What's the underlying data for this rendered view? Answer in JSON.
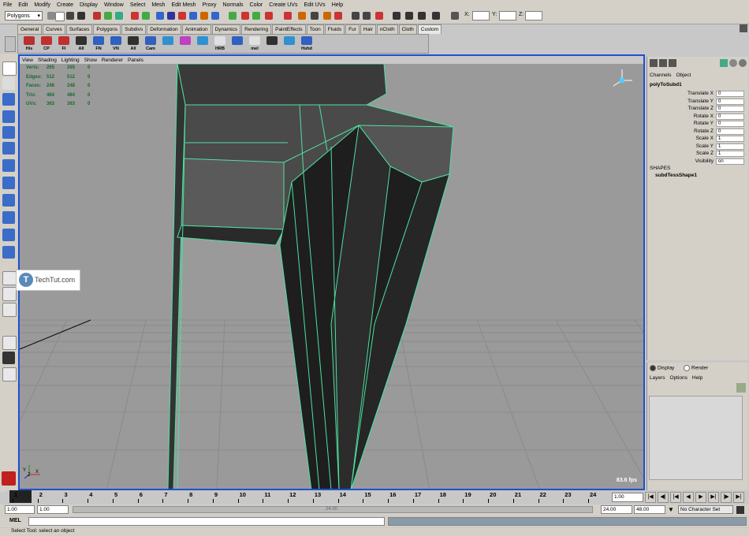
{
  "menubar": [
    "File",
    "Edit",
    "Modify",
    "Create",
    "Display",
    "Window",
    "Select",
    "Mesh",
    "Edit Mesh",
    "Proxy",
    "Normals",
    "Color",
    "Create UVs",
    "Edit UVs",
    "Help"
  ],
  "status": {
    "mode": "Polygons",
    "x_label": "X:",
    "y_label": "Y:",
    "z_label": "Z:"
  },
  "shelf_tabs": [
    "General",
    "Curves",
    "Surfaces",
    "Polygons",
    "Subdivs",
    "Deformation",
    "Animation",
    "Dynamics",
    "Rendering",
    "PaintEffects",
    "Toon",
    "Fluids",
    "Fur",
    "Hair",
    "nCloth",
    "Cloth",
    "Custom"
  ],
  "shelf_active": "Custom",
  "shelf_icons": [
    "His",
    "CP",
    "FI",
    "All",
    "FN",
    "VN",
    "All",
    "Cam",
    "",
    "",
    "",
    "HRB",
    "",
    "mel",
    "",
    "",
    "Hshd"
  ],
  "viewport": {
    "panel_menu": [
      "View",
      "Shading",
      "Lighting",
      "Show",
      "Renderer",
      "Panels"
    ],
    "hud": [
      {
        "label": "Verts:",
        "a": "265",
        "b": "265",
        "c": "0"
      },
      {
        "label": "Edges:",
        "a": "512",
        "b": "512",
        "c": "0"
      },
      {
        "label": "Faces:",
        "a": "248",
        "b": "248",
        "c": "0"
      },
      {
        "label": "Tris:",
        "a": "484",
        "b": "484",
        "c": "0"
      },
      {
        "label": "UVs:",
        "a": "363",
        "b": "363",
        "c": "0"
      }
    ],
    "fps": "83.6 fps",
    "axis_y": "Y",
    "axis_x": "X",
    "axis_z": "Z"
  },
  "watermark": {
    "logo": "T",
    "text": "TechTut.com"
  },
  "channelbox": {
    "menu": [
      "Channels",
      "Object"
    ],
    "node": "polyToSubd1",
    "attrs": [
      {
        "name": "Translate X",
        "value": "0"
      },
      {
        "name": "Translate Y",
        "value": "0"
      },
      {
        "name": "Translate Z",
        "value": "0"
      },
      {
        "name": "Rotate X",
        "value": "0"
      },
      {
        "name": "Rotate Y",
        "value": "0"
      },
      {
        "name": "Rotate Z",
        "value": "0"
      },
      {
        "name": "Scale X",
        "value": "1"
      },
      {
        "name": "Scale Y",
        "value": "1"
      },
      {
        "name": "Scale Z",
        "value": "1"
      },
      {
        "name": "Visibility",
        "value": "on"
      }
    ],
    "shapes_label": "SHAPES",
    "shape": "subdTessShape1"
  },
  "layers": {
    "display": "Display",
    "render": "Render",
    "menu": [
      "Layers",
      "Options",
      "Help"
    ]
  },
  "timeline": {
    "ticks": [
      "1",
      "2",
      "3",
      "4",
      "5",
      "6",
      "7",
      "8",
      "9",
      "10",
      "11",
      "12",
      "13",
      "14",
      "15",
      "16",
      "17",
      "18",
      "19",
      "20",
      "21",
      "22",
      "23",
      "24"
    ],
    "current": "1.00"
  },
  "range": {
    "start": "1.00",
    "start2": "1.00",
    "bar_label": "24.00",
    "end": "24.00",
    "end2": "48.00",
    "charset": "No Character Set"
  },
  "cmd": {
    "label": "MEL"
  },
  "helpline": "Select Tool: select an object"
}
